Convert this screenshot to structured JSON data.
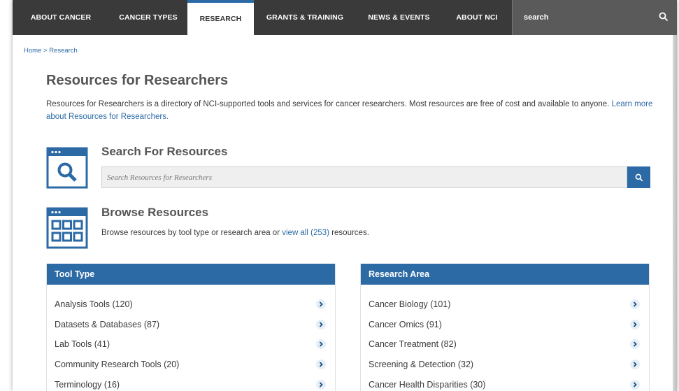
{
  "nav": {
    "items": [
      {
        "label": "ABOUT CANCER",
        "active": false
      },
      {
        "label": "CANCER TYPES",
        "active": false
      },
      {
        "label": "RESEARCH",
        "active": true
      },
      {
        "label": "GRANTS & TRAINING",
        "active": false
      },
      {
        "label": "NEWS & EVENTS",
        "active": false
      },
      {
        "label": "ABOUT NCI",
        "active": false
      }
    ],
    "search_label": "search"
  },
  "breadcrumb": {
    "home": "Home",
    "separator": ">",
    "current": "Research"
  },
  "page": {
    "title": "Resources for Researchers",
    "intro_text": "Resources for Researchers is a directory of NCI-supported tools and services for cancer researchers. Most resources are free of cost and available to anyone.",
    "intro_link": "Learn more about Resources for Researchers."
  },
  "search_section": {
    "title": "Search For Resources",
    "placeholder": "Search Resources for Researchers"
  },
  "browse_section": {
    "title": "Browse Resources",
    "desc_prefix": "Browse resources by tool type or research area or",
    "desc_link": "view all (253)",
    "desc_suffix": "resources."
  },
  "tool_type": {
    "title": "Tool Type",
    "items": [
      "Analysis Tools (120)",
      "Datasets & Databases (87)",
      "Lab Tools (41)",
      "Community Research Tools (20)",
      "Terminology (16)"
    ]
  },
  "research_area": {
    "title": "Research Area",
    "items": [
      "Cancer Biology (101)",
      "Cancer Omics (91)",
      "Cancer Treatment (82)",
      "Screening & Detection (32)",
      "Cancer Health Disparities (30)"
    ]
  },
  "colors": {
    "accent": "#2c6aa6",
    "nav_bg": "#3a3a3a",
    "search_bg": "#5a5a5a"
  }
}
